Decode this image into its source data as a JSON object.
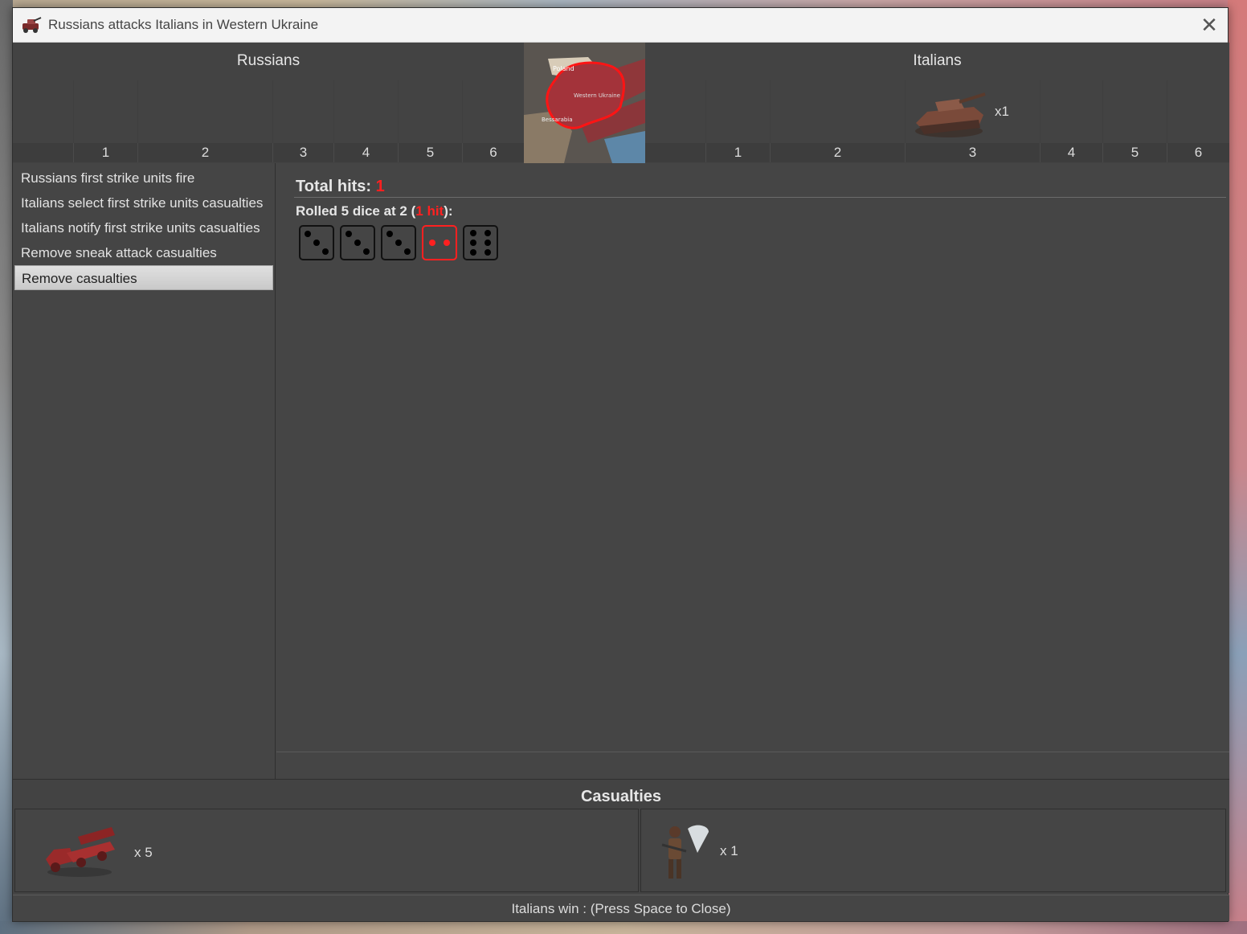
{
  "window": {
    "title": "Russians attacks Italians in Western Ukraine",
    "close_label": "✕"
  },
  "battle": {
    "attacker": "Russians",
    "defender": "Italians",
    "attacker_columns": [
      "1",
      "2",
      "3",
      "4",
      "5",
      "6"
    ],
    "defender_columns": [
      "1",
      "2",
      "3",
      "4",
      "5",
      "6"
    ],
    "defender_unit": {
      "icon": "tank-icon",
      "count": "x1"
    },
    "minimap": {
      "region": "Western Ukraine",
      "labels": [
        "Poland",
        "Western Ukraine",
        "Bessarabia"
      ]
    }
  },
  "steps": [
    "Russians first strike units fire",
    "Italians select first strike units casualties",
    "Italians notify first strike units casualties",
    "Remove sneak attack casualties",
    "Remove casualties"
  ],
  "active_step_index": 4,
  "results": {
    "total_hits_label": "Total hits:",
    "total_hits_value": "1",
    "rolled_prefix": "Rolled 5 dice at 2 (",
    "rolled_hit": "1 hit",
    "rolled_suffix": "):",
    "dice": [
      3,
      3,
      3,
      2,
      6
    ],
    "hit_dice": [
      false,
      false,
      false,
      true,
      false
    ]
  },
  "casualties": {
    "title": "Casualties",
    "attacker": {
      "icon": "rocket-truck-icon",
      "count": "x 5"
    },
    "defender": {
      "icon": "paratrooper-icon",
      "count": "x 1"
    }
  },
  "status": "Italians win : (Press Space to Close)",
  "colors": {
    "hit": "#ff2020",
    "dialog_bg": "#454545"
  }
}
